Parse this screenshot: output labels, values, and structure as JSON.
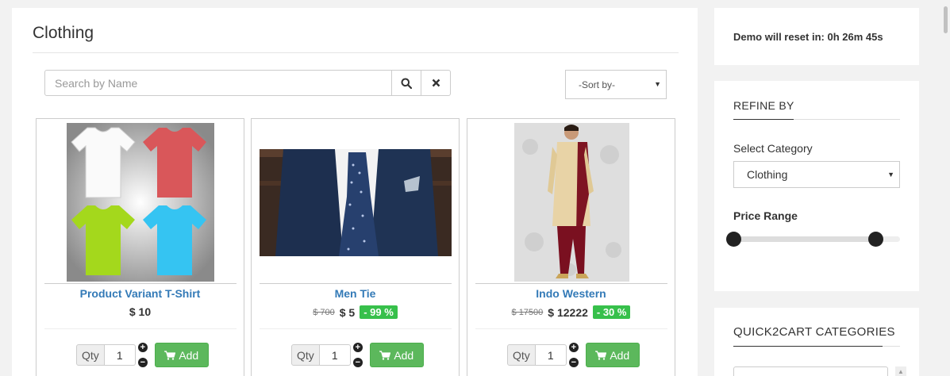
{
  "page": {
    "title": "Clothing"
  },
  "search": {
    "placeholder": "Search by Name",
    "value": ""
  },
  "sort": {
    "selected": "-Sort by-"
  },
  "products": [
    {
      "name": "Product Variant T-Shirt",
      "old_price": "",
      "price": "$ 10",
      "discount": "",
      "qty_label": "Qty",
      "qty": "1",
      "add_label": "Add"
    },
    {
      "name": "Men Tie",
      "old_price": "$ 700",
      "price": "$ 5",
      "discount": "- 99 %",
      "qty_label": "Qty",
      "qty": "1",
      "add_label": "Add"
    },
    {
      "name": "Indo Western",
      "old_price": "$ 17500",
      "price": "$ 12222",
      "discount": "- 30 %",
      "qty_label": "Qty",
      "qty": "1",
      "add_label": "Add"
    }
  ],
  "sidebar": {
    "reset_notice": "Demo will reset in: 0h 26m 45s",
    "refine_title": "REFINE BY",
    "select_category_label": "Select Category",
    "category_selected": "Clothing",
    "price_range_label": "Price Range",
    "price_range": {
      "min_fraction": 0.0,
      "max_fraction": 0.85
    },
    "categories_title": "QUICK2CART CATEGORIES"
  },
  "colors": {
    "link": "#337ab7",
    "discount_badge": "#37c04b",
    "add_button": "#5cb85c"
  }
}
